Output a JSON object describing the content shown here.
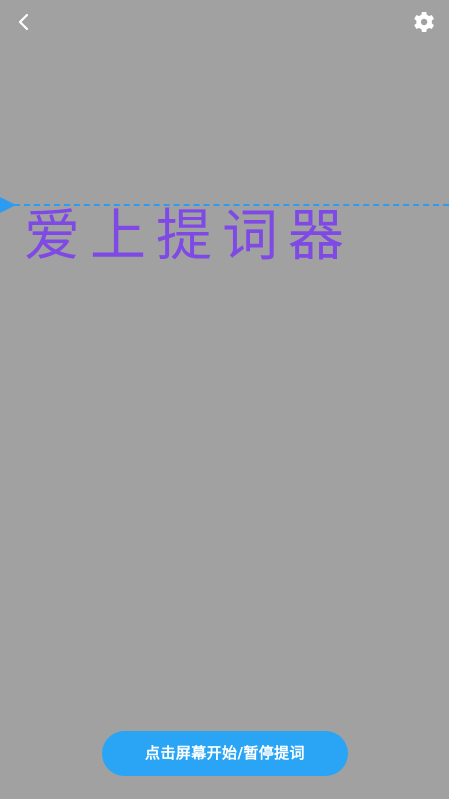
{
  "topbar": {
    "back_icon": "chevron-left-icon",
    "settings_icon": "gear-icon"
  },
  "prompter": {
    "script_text": "爱上提词器",
    "text_color": "#7f49e6",
    "background_color": "#a1a1a1",
    "guide_color": "#2b9cf2"
  },
  "controls": {
    "start_pause_label": "点击屏幕开始/暂停提词",
    "button_color": "#2aa5f5"
  }
}
